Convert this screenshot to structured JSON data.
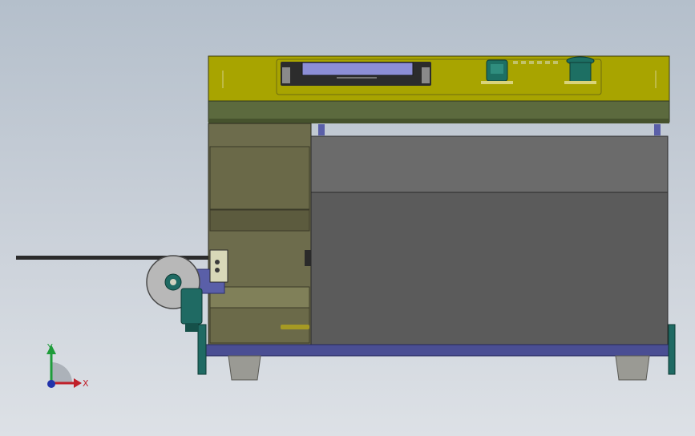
{
  "model": {
    "description_hidden": false
  },
  "triad": {
    "x_label": "X",
    "y_label": "Y",
    "x_color": "#c0202a",
    "y_color": "#1e9c3a",
    "z_color": "#2233aa"
  },
  "colors": {
    "background_top": "#b4bfcb",
    "control_panel": "#a8a400",
    "display_screen": "#8c8ed6",
    "upper_cabinet": "#6b6b6b",
    "lower_cabinet": "#5b5b5b",
    "side_compartment": "#6d6c4c",
    "base_rail": "#4a4e93",
    "feet": "#9a9a94",
    "shaft": "#2a2a2a",
    "disc": "#b8b8b8"
  }
}
